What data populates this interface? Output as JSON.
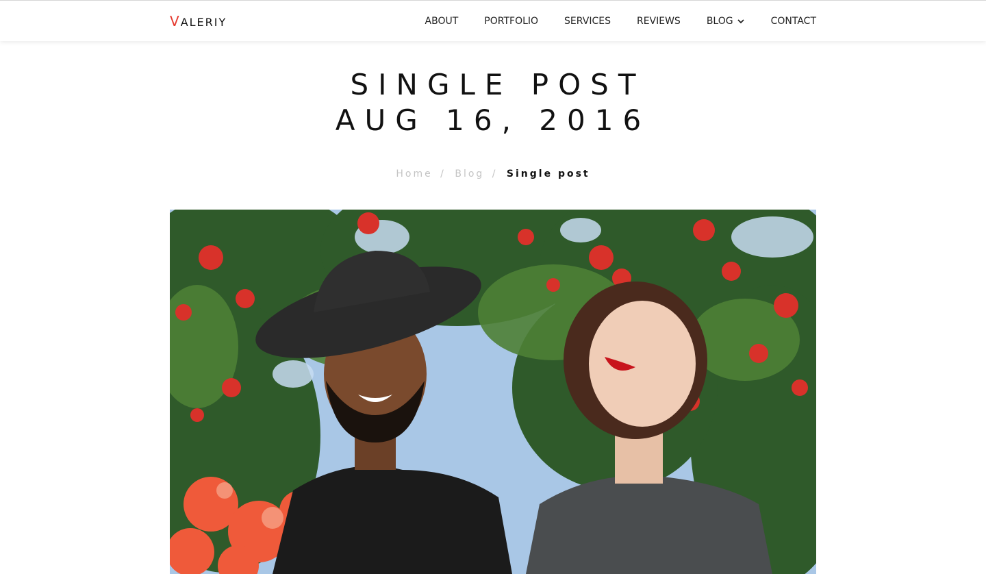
{
  "brand": {
    "logo_first": "V",
    "logo_rest": "ALERIY",
    "accent_color": "#e53a2f"
  },
  "nav": {
    "items": [
      {
        "label": "ABOUT"
      },
      {
        "label": "PORTFOLIO"
      },
      {
        "label": "SERVICES"
      },
      {
        "label": "REVIEWS"
      },
      {
        "label": "BLOG",
        "icon": "chevron-down-icon"
      },
      {
        "label": "CONTACT"
      }
    ]
  },
  "page": {
    "title_line1": "SINGLE POST",
    "title_line2": "AUG 16, 2016"
  },
  "breadcrumb": {
    "home": "Home",
    "blog": "Blog",
    "separator": "/",
    "current": "Single post"
  },
  "hero": {
    "image_icon": "photo-image"
  }
}
